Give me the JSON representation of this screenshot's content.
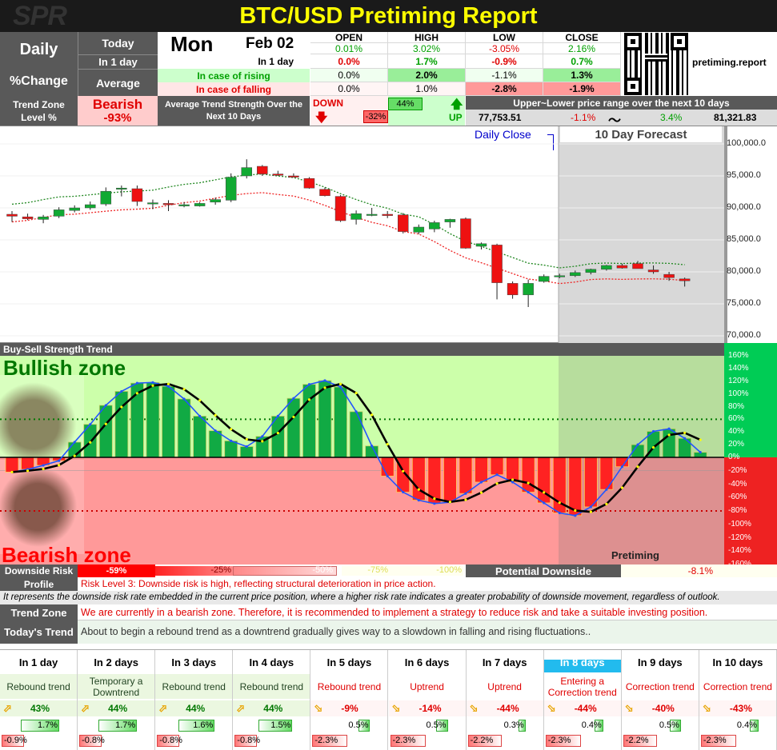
{
  "header": {
    "logo": "SPR",
    "title": "BTC/USD Pretiming Report"
  },
  "left_panel": {
    "period": "Daily",
    "change": "%Change",
    "today": "Today",
    "in1day": "In 1 day",
    "average": "Average"
  },
  "date": {
    "day": "Mon",
    "date": "Feb 02"
  },
  "ohlc": {
    "headers": [
      "OPEN",
      "HIGH",
      "LOW",
      "CLOSE"
    ],
    "today": [
      "0.01%",
      "3.02%",
      "-3.05%",
      "2.16%"
    ],
    "in1day_label": "In 1 day",
    "in1day": [
      "0.0%",
      "1.7%",
      "-0.9%",
      "0.7%"
    ],
    "rising_label": "In case of rising",
    "rising": [
      "0.0%",
      "2.0%",
      "-1.1%",
      "1.3%"
    ],
    "falling_label": "In case of falling",
    "falling": [
      "0.0%",
      "1.0%",
      "-2.8%",
      "-1.9%"
    ]
  },
  "site": "pretiming.report",
  "trend_zone": {
    "label1": "Trend Zone",
    "label2": "Level %",
    "zone": "Bearish",
    "level": "-93%",
    "avg_label": "Average Trend Strength Over the Next 10 Days",
    "down_label": "DOWN",
    "down_value": "-32%",
    "up_value": "44%",
    "up_label": "UP",
    "range_label": "Upper~Lower price range over the next 10 days",
    "low_price": "77,753.51",
    "low_pct": "-1.1%",
    "tilde": "〜",
    "high_pct": "3.4%",
    "high_price": "81,321.83"
  },
  "price_chart": {
    "daily_close": "Daily Close",
    "forecast": "10 Day Forecast",
    "y_labels": [
      "100,000.0",
      "95,000.0",
      "90,000.0",
      "85,000.0",
      "80,000.0",
      "75,000.0",
      "70,000.0"
    ]
  },
  "chart_data": [
    {
      "type": "candlestick",
      "title": "",
      "ylim": [
        70000,
        100000
      ],
      "candles": [
        [
          89000,
          89500,
          87800,
          88700
        ],
        [
          88600,
          89100,
          88100,
          88300
        ],
        [
          88200,
          88900,
          87600,
          88600
        ],
        [
          88700,
          90100,
          88400,
          89700
        ],
        [
          89600,
          90400,
          89300,
          90000
        ],
        [
          90000,
          91000,
          89700,
          90500
        ],
        [
          90600,
          93200,
          90300,
          92600
        ],
        [
          93000,
          93500,
          91800,
          93100
        ],
        [
          93000,
          93500,
          90300,
          91000
        ],
        [
          90800,
          91300,
          89800,
          90800
        ],
        [
          90700,
          91200,
          89500,
          90500
        ],
        [
          90300,
          90900,
          90100,
          90500
        ],
        [
          90300,
          90900,
          90200,
          90700
        ],
        [
          90900,
          91600,
          90500,
          91300
        ],
        [
          91200,
          95400,
          90900,
          94800
        ],
        [
          95000,
          97600,
          94600,
          96300
        ],
        [
          96500,
          96700,
          95000,
          95300
        ],
        [
          95300,
          95800,
          95000,
          95100
        ],
        [
          95000,
          95400,
          94800,
          94800
        ],
        [
          94600,
          94800,
          93000,
          93100
        ],
        [
          92900,
          93200,
          91800,
          91900
        ],
        [
          91800,
          92000,
          87800,
          88000
        ],
        [
          88200,
          89600,
          87400,
          89100
        ],
        [
          89000,
          90000,
          88700,
          89000
        ],
        [
          89000,
          89500,
          88400,
          88800
        ],
        [
          88900,
          89200,
          86000,
          86300
        ],
        [
          86200,
          87400,
          85900,
          87000
        ],
        [
          86700,
          88000,
          86200,
          87700
        ],
        [
          87800,
          88300,
          86900,
          88200
        ],
        [
          88300,
          88500,
          83600,
          83700
        ],
        [
          84000,
          84600,
          83500,
          84400
        ],
        [
          84200,
          84400,
          75700,
          78300
        ],
        [
          78200,
          78500,
          75800,
          76400
        ],
        [
          76400,
          78800,
          74500,
          78200
        ]
      ],
      "forecast_candles": [
        [
          78500,
          79600,
          78300,
          79300
        ],
        [
          79300,
          79700,
          79000,
          79400
        ],
        [
          79400,
          80200,
          79200,
          79900
        ],
        [
          79900,
          80500,
          79600,
          80400
        ],
        [
          80400,
          81100,
          80200,
          81000
        ],
        [
          81000,
          81300,
          80500,
          80600
        ],
        [
          81300,
          81700,
          80500,
          80500
        ],
        [
          80300,
          81000,
          79700,
          80000
        ],
        [
          79600,
          80000,
          78600,
          79100
        ],
        [
          78900,
          79100,
          77700,
          78600
        ]
      ]
    },
    {
      "type": "bar",
      "title": "Buy-Sell Strength Trend",
      "ylim": [
        -160,
        160
      ],
      "y_labels": [
        "160%",
        "140%",
        "120%",
        "100%",
        "80%",
        "60%",
        "40%",
        "20%",
        "0%",
        "-20%",
        "-40%",
        "-60%",
        "-80%",
        "-100%",
        "-120%",
        "-140%",
        "-160%"
      ],
      "values": [
        -22,
        -18,
        -12,
        -5,
        24,
        52,
        82,
        104,
        117,
        118,
        112,
        92,
        65,
        42,
        26,
        17,
        33,
        65,
        93,
        115,
        121,
        111,
        72,
        18,
        -28,
        -52,
        -64,
        -69,
        -67,
        -54,
        -37,
        -26,
        -37,
        -52,
        -68,
        -83,
        -87,
        -74
      ],
      "forecast_values": [
        -48,
        -14,
        20,
        41,
        45,
        30,
        8
      ]
    }
  ],
  "osc": {
    "bullish": "Bullish zone",
    "bearish": "Bearish zone",
    "brand": "Pretiming"
  },
  "downside": {
    "label": "Downside Risk",
    "levels": [
      "-59%",
      "-25%",
      "-50%",
      "-75%",
      "-100%"
    ],
    "potential_label": "Potential Downside",
    "potential_value": "-8.1%"
  },
  "profile": {
    "label": "Profile",
    "text": "Risk Level 3: Downside risk is high, reflecting structural deterioration in price action.",
    "note": "It represents the downside risk rate embedded in the current price position, where a higher risk rate indicates a greater probability of downside movement, regardless of outlook."
  },
  "trend_zone_text": {
    "label": "Trend Zone",
    "text": "We are currently in a bearish zone. Therefore, it is recommended to implement a strategy to reduce risk and take a suitable investing position."
  },
  "todays_trend": {
    "label": "Today's Trend",
    "text": "About to begin a rebound trend as a downtrend gradually gives way to a slowdown in falling and rising fluctuations.."
  },
  "forecast": [
    {
      "day": "In 1 day",
      "trend": "Rebound trend",
      "dir": "up",
      "strength": "43%",
      "up": "1.7%",
      "up_v": 1.7,
      "down": "-0.9%",
      "down_v": 0.9
    },
    {
      "day": "In 2 days",
      "trend": "Temporary a Downtrend",
      "dir": "up",
      "strength": "44%",
      "up": "1.7%",
      "up_v": 1.7,
      "down": "-0.8%",
      "down_v": 0.8
    },
    {
      "day": "In 3 days",
      "trend": "Rebound trend",
      "dir": "up",
      "strength": "44%",
      "up": "1.6%",
      "up_v": 1.6,
      "down": "-0.8%",
      "down_v": 0.8
    },
    {
      "day": "In 4 days",
      "trend": "Rebound trend",
      "dir": "up",
      "strength": "44%",
      "up": "1.5%",
      "up_v": 1.5,
      "down": "-0.8%",
      "down_v": 0.8
    },
    {
      "day": "In 5 days",
      "trend": "Rebound trend",
      "dir": "down",
      "strength": "-9%",
      "up": "0.5%",
      "up_v": 0.5,
      "down": "-2.3%",
      "down_v": 2.3
    },
    {
      "day": "In 6 days",
      "trend": "Uptrend",
      "dir": "down",
      "strength": "-14%",
      "up": "0.5%",
      "up_v": 0.5,
      "down": "-2.3%",
      "down_v": 2.3
    },
    {
      "day": "In 7 days",
      "trend": "Uptrend",
      "dir": "down",
      "strength": "-44%",
      "up": "0.3%",
      "up_v": 0.3,
      "down": "-2.2%",
      "down_v": 2.2
    },
    {
      "day": "In 8 days",
      "trend": "Entering a Correction trend",
      "dir": "down",
      "strength": "-44%",
      "up": "0.4%",
      "up_v": 0.4,
      "down": "-2.3%",
      "down_v": 2.3
    },
    {
      "day": "In 9 days",
      "trend": "Correction trend",
      "dir": "down",
      "strength": "-40%",
      "up": "0.5%",
      "up_v": 0.5,
      "down": "-2.2%",
      "down_v": 2.2
    },
    {
      "day": "In 10 days",
      "trend": "Correction trend",
      "dir": "down",
      "strength": "-43%",
      "up": "0.4%",
      "up_v": 0.4,
      "down": "-2.3%",
      "down_v": 2.3
    }
  ],
  "colors": {
    "bull_bg": "#ccffaa",
    "bear_bg": "#ff9999",
    "title_yellow": "#ffff00",
    "header_bg": "#1a1a1a",
    "dark": "#595959",
    "up": "#00a000",
    "down": "#e00000"
  }
}
